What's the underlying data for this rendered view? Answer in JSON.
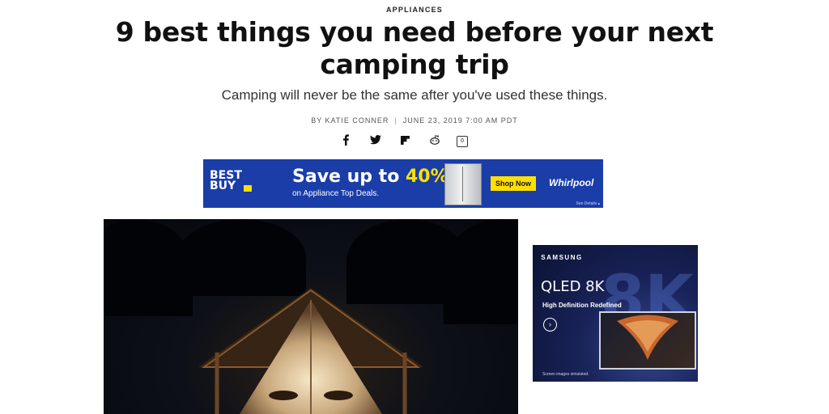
{
  "article": {
    "category": "APPLIANCES",
    "headline": "9 best things you need before your next camping trip",
    "dek": "Camping will never be the same after you've used these things.",
    "author": "BY KATIE CONNER",
    "date": "JUNE 23, 2019 7:00 AM PDT",
    "comment_count": "0"
  },
  "share_icons": [
    "facebook-icon",
    "twitter-icon",
    "flipboard-icon",
    "reddit-icon",
    "comment-icon"
  ],
  "ad_bestbuy": {
    "logo_line1": "BEST",
    "logo_line2": "BUY",
    "headline_prefix": "Save up to ",
    "headline_pct": "40%",
    "sub": "on Appliance Top Deals.",
    "cta": "Shop Now",
    "brand": "Whirlpool",
    "details": "See Details",
    "colors": {
      "background": "#1a3da8",
      "accent": "#ffe000"
    }
  },
  "ad_samsung": {
    "brand": "SAMSUNG",
    "title": "QLED 8K",
    "subtitle": "High Definition Redefined",
    "watermark": "8K",
    "footnote": "Screen images simulated."
  },
  "hero": {
    "image": "lit canvas tent at night in forest"
  }
}
